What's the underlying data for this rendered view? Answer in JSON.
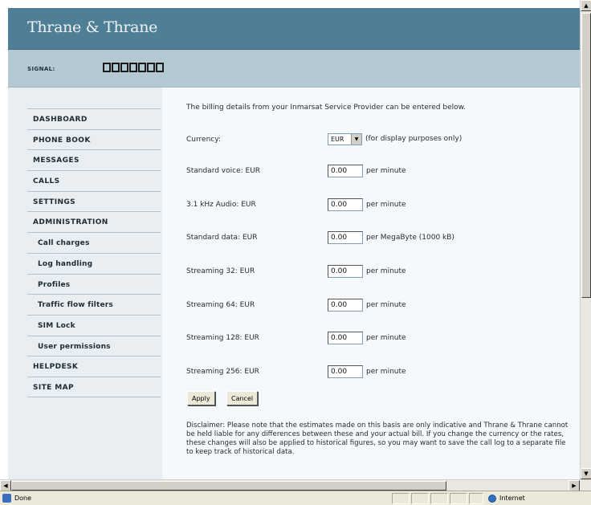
{
  "brand": {
    "name": "Thrane & Thrane"
  },
  "signal": {
    "label": "SIGNAL:",
    "bars": 7
  },
  "nav": {
    "items": [
      {
        "label": "DASHBOARD"
      },
      {
        "label": "PHONE BOOK"
      },
      {
        "label": "MESSAGES"
      },
      {
        "label": "CALLS"
      },
      {
        "label": "SETTINGS"
      },
      {
        "label": "ADMINISTRATION"
      },
      {
        "label": "Call charges"
      },
      {
        "label": "Log handling"
      },
      {
        "label": "Profiles"
      },
      {
        "label": "Traffic flow filters"
      },
      {
        "label": "SIM Lock"
      },
      {
        "label": "User permissions"
      },
      {
        "label": "HELPDESK"
      },
      {
        "label": "SITE MAP"
      }
    ]
  },
  "main": {
    "intro": "The billing details from your Inmarsat Service Provider can be entered below.",
    "currency": {
      "label": "Currency:",
      "value": "EUR",
      "note": "(for display purposes only)"
    },
    "rates": [
      {
        "label": "Standard voice: EUR",
        "value": "0.00",
        "unit": "per minute"
      },
      {
        "label": "3.1 kHz Audio: EUR",
        "value": "0.00",
        "unit": "per minute"
      },
      {
        "label": "Standard data: EUR",
        "value": "0.00",
        "unit": "per MegaByte (1000 kB)"
      },
      {
        "label": "Streaming 32: EUR",
        "value": "0.00",
        "unit": "per minute"
      },
      {
        "label": "Streaming 64: EUR",
        "value": "0.00",
        "unit": "per minute"
      },
      {
        "label": "Streaming 128: EUR",
        "value": "0.00",
        "unit": "per minute"
      },
      {
        "label": "Streaming 256: EUR",
        "value": "0.00",
        "unit": "per minute"
      }
    ],
    "apply_label": "Apply",
    "cancel_label": "Cancel",
    "disclaimer": "Disclaimer: Please note that the estimates made on this basis are only indicative and Thrane & Thrane cannot be held liable for any differences between these and your actual bill. If you change the currency or the rates, these changes will also be applied to historical figures, so you may want to save the call log to a separate file to keep track of historical data."
  },
  "status": {
    "text": "Done",
    "zone": "Internet"
  },
  "colors": {
    "header": "#4f7f96",
    "signal_bar": "#b5c9d3",
    "nav_background": "#e8eef2",
    "content_background": "#f6f9fb"
  }
}
